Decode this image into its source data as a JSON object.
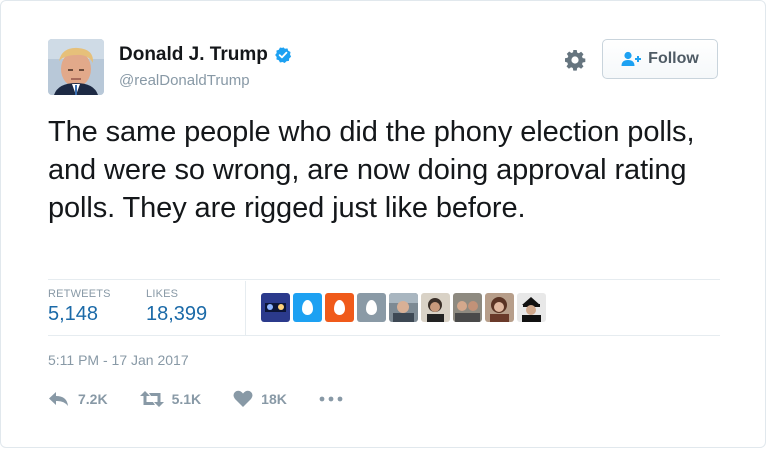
{
  "user": {
    "name": "Donald J. Trump",
    "handle": "@realDonaldTrump",
    "verified": true
  },
  "follow_button": {
    "label": "Follow"
  },
  "tweet": {
    "text": "The same people who did the phony election polls, and were so wrong, are now doing approval rating polls. They are rigged just like before.",
    "timestamp": "5:11 PM - 17 Jan 2017"
  },
  "stats": {
    "retweets_label": "RETWEETS",
    "retweets_value": "5,148",
    "likes_label": "LIKES",
    "likes_value": "18,399"
  },
  "likers": [
    {
      "kind": "photo",
      "icon": "avatar-photo"
    },
    {
      "kind": "egg",
      "color": "#1da1f2",
      "icon": "egg-avatar"
    },
    {
      "kind": "egg",
      "color": "#f05a1a",
      "icon": "egg-avatar"
    },
    {
      "kind": "egg",
      "color": "#8a9aa6",
      "icon": "egg-avatar"
    },
    {
      "kind": "photo",
      "icon": "avatar-photo"
    },
    {
      "kind": "photo",
      "icon": "avatar-photo"
    },
    {
      "kind": "photo",
      "icon": "avatar-photo"
    },
    {
      "kind": "photo",
      "icon": "avatar-photo"
    },
    {
      "kind": "photo",
      "icon": "avatar-photo"
    }
  ],
  "actions": {
    "reply_count": "7.2K",
    "retweet_count": "5.1K",
    "like_count": "18K"
  },
  "colors": {
    "link_blue": "#1b6aa8",
    "muted_gray": "#8899a6",
    "verified_blue": "#1da1f2"
  }
}
